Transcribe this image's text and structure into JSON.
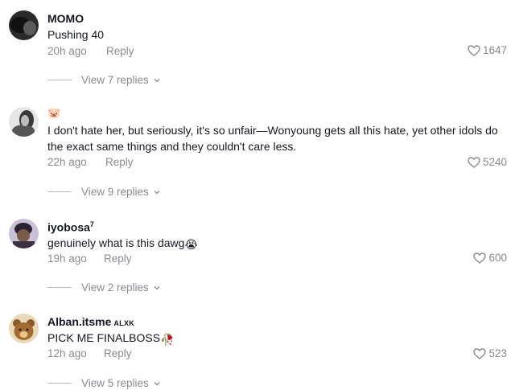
{
  "comments": [
    {
      "username": "MOMO",
      "text": "Pushing 40",
      "time": "20h ago",
      "reply_label": "Reply",
      "likes": "1647",
      "view_replies": "View 7 replies"
    },
    {
      "username": "🐷",
      "text": "I don't hate her, but seriously, it's so unfair—Wonyoung gets all this hate, yet other idols do the exact same things and they couldn't care less.",
      "time": "22h ago",
      "reply_label": "Reply",
      "likes": "5240",
      "view_replies": "View 9 replies"
    },
    {
      "username": "iyobosa",
      "username_sup": "7",
      "text": "genuinely what is this dawg",
      "text_emoji": "😭",
      "time": "19h ago",
      "reply_label": "Reply",
      "likes": "600",
      "view_replies": "View 2 replies"
    },
    {
      "username": "Alban.itsme",
      "badge": "ALXK",
      "text": "PICK ME FINALBOSS",
      "text_emoji": "🥀",
      "time": "12h ago",
      "reply_label": "Reply",
      "likes": "523",
      "view_replies": "View 5 replies"
    }
  ],
  "colors": {
    "text": "#161823",
    "muted": "#8a8b91"
  }
}
